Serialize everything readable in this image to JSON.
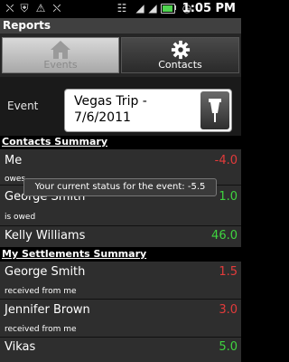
{
  "status_bar": {
    "time": "1:05 PM",
    "icons": [
      "usb-icon",
      "shield-icon",
      "warning-icon",
      "usb-icon",
      "wifi-icon",
      "signal-icon",
      "battery-icon",
      "alarm-icon"
    ]
  },
  "app": {
    "title": "Reports"
  },
  "tabs": [
    {
      "label": "Events",
      "icon": "house-icon",
      "selected": false
    },
    {
      "label": "Contacts",
      "icon": "gear-icon",
      "selected": true
    }
  ],
  "event_picker": {
    "label": "Event",
    "value": "Vegas Trip - 7/6/2011"
  },
  "contacts_summary": {
    "header": "Contacts Summary",
    "rows": [
      {
        "name": "Me",
        "sub": "owes",
        "value": "-4.0",
        "color": "#e33b3b"
      },
      {
        "name": "George Smith",
        "sub": "is owed",
        "value": "1.0",
        "color": "#3fd43f"
      },
      {
        "name": "Kelly Williams",
        "sub": "",
        "value": "46.0",
        "color": "#3fd43f"
      }
    ]
  },
  "settlements_summary": {
    "header": "My Settlements Summary",
    "rows": [
      {
        "name": "George Smith",
        "sub": "received from me",
        "value": "1.5",
        "color": "#e33b3b"
      },
      {
        "name": "Jennifer Brown",
        "sub": "received from me",
        "value": "3.0",
        "color": "#e33b3b"
      },
      {
        "name": "Vikas",
        "sub": "",
        "value": "5.0",
        "color": "#3fd43f"
      }
    ]
  },
  "toast": {
    "text": "Your current status for the event: -5.5"
  }
}
